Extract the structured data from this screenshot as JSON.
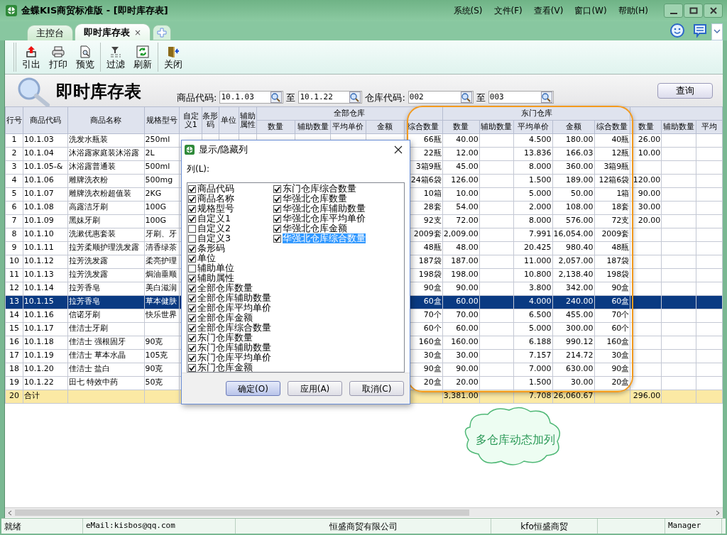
{
  "window": {
    "title": "金蝶KIS商贸标准版 - [即时库存表]",
    "menu": [
      "系统(S)",
      "文件(F)",
      "查看(V)",
      "窗口(W)",
      "帮助(H)"
    ]
  },
  "tabs": [
    {
      "label": "主控台",
      "selected": false
    },
    {
      "label": "即时库存表",
      "selected": true,
      "close": "×"
    }
  ],
  "toolbar": {
    "groups": [
      {
        "buttons": [
          {
            "label": "引出",
            "kind": "export"
          },
          {
            "label": "打印",
            "kind": "print"
          },
          {
            "label": "预览",
            "kind": "preview"
          }
        ]
      },
      {
        "buttons": [
          {
            "label": "过滤",
            "kind": "filter"
          },
          {
            "label": "刷新",
            "kind": "refresh"
          }
        ]
      },
      {
        "buttons": [
          {
            "label": "关闭",
            "kind": "close"
          }
        ]
      }
    ]
  },
  "report": {
    "title": "即时库存表",
    "filters": [
      {
        "label": "商品代码:",
        "from": "10.1.03",
        "to_label": "至",
        "to": "10.1.22"
      },
      {
        "label": "仓库代码:",
        "from": "002",
        "to_label": "至",
        "to": "003"
      }
    ],
    "query_button": "查询"
  },
  "table": {
    "columns": [
      "行号",
      "商品代码",
      "商品名称",
      "规格型号",
      "自定义1",
      "条形码",
      "单位",
      "辅助属性"
    ],
    "groups": [
      {
        "title": "全部仓库",
        "columns": [
          "数量",
          "辅助数量",
          "平均单价",
          "金额",
          "综合数量"
        ]
      },
      {
        "title": "东门仓库",
        "columns": [
          "数量",
          "辅助数量",
          "平均单价",
          "金额",
          "综合数量"
        ]
      },
      {
        "columns": [
          "数量",
          "辅助数量",
          "平均"
        ]
      }
    ],
    "rows": [
      {
        "kind": "item",
        "selected": false,
        "no": "1",
        "code": "10.1.03",
        "name": "洗发水瓶装",
        "spec": "250ml",
        "all_mixed": "66瓶",
        "east": {
          "qty": "40.00",
          "avg": "4.500",
          "amount": "180.00",
          "mixed": "40瓶"
        },
        "other_qty": "26.00"
      },
      {
        "kind": "item",
        "selected": false,
        "no": "2",
        "code": "10.1.04",
        "name": "沐浴露家庭装沐浴露",
        "spec": "2L",
        "all_mixed": "22瓶",
        "east": {
          "qty": "12.00",
          "avg": "13.836",
          "amount": "166.03",
          "mixed": "12瓶"
        },
        "other_qty": "10.00"
      },
      {
        "kind": "item",
        "selected": false,
        "no": "3",
        "code": "10.1.05-&",
        "name": "沐浴露普通装",
        "spec": "500ml",
        "all_mixed": "3箱9瓶",
        "east": {
          "qty": "45.00",
          "avg": "8.000",
          "amount": "360.00",
          "mixed": "3箱9瓶"
        }
      },
      {
        "kind": "item",
        "selected": false,
        "no": "4",
        "code": "10.1.06",
        "name": "雕牌洗衣粉",
        "spec": "500mg",
        "all_mixed": "24箱6袋",
        "east": {
          "qty": "126.00",
          "avg": "1.500",
          "amount": "189.00",
          "mixed": "12箱6袋"
        },
        "other_qty": "120.00"
      },
      {
        "kind": "item",
        "selected": false,
        "no": "5",
        "code": "10.1.07",
        "name": "雕牌洗衣粉超值装",
        "spec": "2KG",
        "all_mixed": "10箱",
        "east": {
          "qty": "10.00",
          "avg": "5.000",
          "amount": "50.00",
          "mixed": "1箱"
        },
        "other_qty": "90.00"
      },
      {
        "kind": "item",
        "selected": false,
        "no": "6",
        "code": "10.1.08",
        "name": "高露洁牙刷",
        "spec": "100G",
        "all_mixed": "28套",
        "east": {
          "qty": "54.00",
          "avg": "2.000",
          "amount": "108.00",
          "mixed": "18套"
        },
        "other_qty": "30.00"
      },
      {
        "kind": "item",
        "selected": false,
        "no": "7",
        "code": "10.1.09",
        "name": "黑妹牙刷",
        "spec": "100G",
        "all_mixed": "92支",
        "east": {
          "qty": "72.00",
          "avg": "8.000",
          "amount": "576.00",
          "mixed": "72支"
        },
        "other_qty": "20.00"
      },
      {
        "kind": "item",
        "selected": false,
        "no": "8",
        "code": "10.1.10",
        "name": "洗漱优惠套装",
        "spec": "牙刷、牙",
        "all_mixed": "2009套",
        "east": {
          "qty": "2,009.00",
          "avg": "7.991",
          "amount": "16,054.00",
          "mixed": "2009套"
        }
      },
      {
        "kind": "item",
        "selected": false,
        "no": "9",
        "code": "10.1.11",
        "name": "拉芳柔顺护理洗发露",
        "spec": "清香绿茶",
        "all_mixed": "48瓶",
        "east": {
          "qty": "48.00",
          "avg": "20.425",
          "amount": "980.40",
          "mixed": "48瓶"
        }
      },
      {
        "kind": "item",
        "selected": false,
        "no": "10",
        "code": "10.1.12",
        "name": "拉芳洗发露",
        "spec": "柔亮护理",
        "all_mixed": "187袋",
        "east": {
          "qty": "187.00",
          "avg": "11.000",
          "amount": "2,057.00",
          "mixed": "187袋"
        }
      },
      {
        "kind": "item",
        "selected": false,
        "no": "11",
        "code": "10.1.13",
        "name": "拉芳洗发露",
        "spec": "焗油垂顺",
        "all_mixed": "198袋",
        "east": {
          "qty": "198.00",
          "avg": "10.800",
          "amount": "2,138.40",
          "mixed": "198袋"
        }
      },
      {
        "kind": "item",
        "selected": false,
        "no": "12",
        "code": "10.1.14",
        "name": "拉芳香皂",
        "spec": "美白滋润",
        "all_mixed": "90盒",
        "east": {
          "qty": "90.00",
          "avg": "3.800",
          "amount": "342.00",
          "mixed": "90盒"
        }
      },
      {
        "kind": "item",
        "selected": true,
        "no": "13",
        "code": "10.1.15",
        "name": "拉芳香皂",
        "spec": "草本健肤",
        "all_mixed": "60盒",
        "east": {
          "qty": "60.00",
          "avg": "4.000",
          "amount": "240.00",
          "mixed": "60盒"
        }
      },
      {
        "kind": "item",
        "selected": false,
        "no": "14",
        "code": "10.1.16",
        "name": "信诺牙刷",
        "spec": "快乐世界",
        "all_mixed": "70个",
        "east": {
          "qty": "70.00",
          "avg": "6.500",
          "amount": "455.00",
          "mixed": "70个"
        }
      },
      {
        "kind": "item",
        "selected": false,
        "no": "15",
        "code": "10.1.17",
        "name": "佳洁士牙刷",
        "all_mixed": "60个",
        "east": {
          "qty": "60.00",
          "avg": "5.000",
          "amount": "300.00",
          "mixed": "60个"
        }
      },
      {
        "kind": "item",
        "selected": false,
        "no": "16",
        "code": "10.1.18",
        "name": "佳洁士 强根固牙",
        "spec": "90克",
        "all_mixed": "160盒",
        "east": {
          "qty": "160.00",
          "avg": "6.188",
          "amount": "990.12",
          "mixed": "160盒"
        }
      },
      {
        "kind": "item",
        "selected": false,
        "no": "17",
        "code": "10.1.19",
        "name": "佳洁士 草本水晶",
        "spec": "105克",
        "all_mixed": "30盒",
        "east": {
          "qty": "30.00",
          "avg": "7.157",
          "amount": "214.72",
          "mixed": "30盒"
        }
      },
      {
        "kind": "item",
        "selected": false,
        "no": "18",
        "code": "10.1.20",
        "name": "佳洁士 盐白",
        "spec": "90克",
        "all_mixed": "90盒",
        "east": {
          "qty": "90.00",
          "avg": "7.000",
          "amount": "630.00",
          "mixed": "90盒"
        }
      },
      {
        "kind": "item",
        "selected": false,
        "no": "19",
        "code": "10.1.22",
        "name": "田七 特效中药",
        "spec": "50克",
        "all_mixed": "20盒",
        "east": {
          "qty": "20.00",
          "avg": "1.500",
          "amount": "30.00",
          "mixed": "20盒"
        }
      },
      {
        "kind": "total",
        "selected": false,
        "no": "20",
        "label": "合计",
        "east": {
          "qty": "3,381.00",
          "avg": "7.708",
          "amount": "26,060.67"
        },
        "other_qty": "296.00"
      }
    ]
  },
  "dialog": {
    "title": "显示/隐藏列",
    "list_label": "列(L):",
    "items": [
      {
        "label": "商品代码",
        "checked": true,
        "selected": false
      },
      {
        "label": "商品名称",
        "checked": true,
        "selected": false
      },
      {
        "label": "规格型号",
        "checked": true,
        "selected": false
      },
      {
        "label": "自定义1",
        "checked": true,
        "selected": false
      },
      {
        "label": "自定义2",
        "checked": false,
        "selected": false
      },
      {
        "label": "自定义3",
        "checked": false,
        "selected": false
      },
      {
        "label": "条形码",
        "checked": true,
        "selected": false
      },
      {
        "label": "单位",
        "checked": true,
        "selected": false
      },
      {
        "label": "辅助单位",
        "checked": false,
        "selected": false
      },
      {
        "label": "辅助属性",
        "checked": true,
        "selected": false
      },
      {
        "label": "全部仓库数量",
        "checked": true,
        "selected": false
      },
      {
        "label": "全部仓库辅助数量",
        "checked": true,
        "selected": false
      },
      {
        "label": "全部仓库平均单价",
        "checked": true,
        "selected": false
      },
      {
        "label": "全部仓库金额",
        "checked": true,
        "selected": false
      },
      {
        "label": "全部仓库综合数量",
        "checked": true,
        "selected": false
      },
      {
        "label": "东门仓库数量",
        "checked": true,
        "selected": false
      },
      {
        "label": "东门仓库辅助数量",
        "checked": true,
        "selected": false
      },
      {
        "label": "东门仓库平均单价",
        "checked": true,
        "selected": false
      },
      {
        "label": "东门仓库金额",
        "checked": true,
        "selected": false
      },
      {
        "label": "东门仓库综合数量",
        "checked": true,
        "selected": false
      },
      {
        "label": "华强北仓库数量",
        "checked": true,
        "selected": false
      },
      {
        "label": "华强北仓库辅助数量",
        "checked": true,
        "selected": false
      },
      {
        "label": "华强北仓库平均单价",
        "checked": true,
        "selected": false
      },
      {
        "label": "华强北仓库金额",
        "checked": true,
        "selected": false
      },
      {
        "label": "华强北仓库综合数量",
        "checked": true,
        "selected": true
      }
    ],
    "buttons": [
      {
        "label": "确定(O)",
        "default": true
      },
      {
        "label": "应用(A)",
        "default": false
      },
      {
        "label": "取消(C)",
        "default": false
      }
    ]
  },
  "annotation": {
    "text": "多仓库动态加列"
  },
  "status_bar": [
    "就绪",
    "eMail:kisbos@qq.com",
    "恒盛商贸有限公司",
    "kfo恒盛商贸",
    "Manager"
  ]
}
